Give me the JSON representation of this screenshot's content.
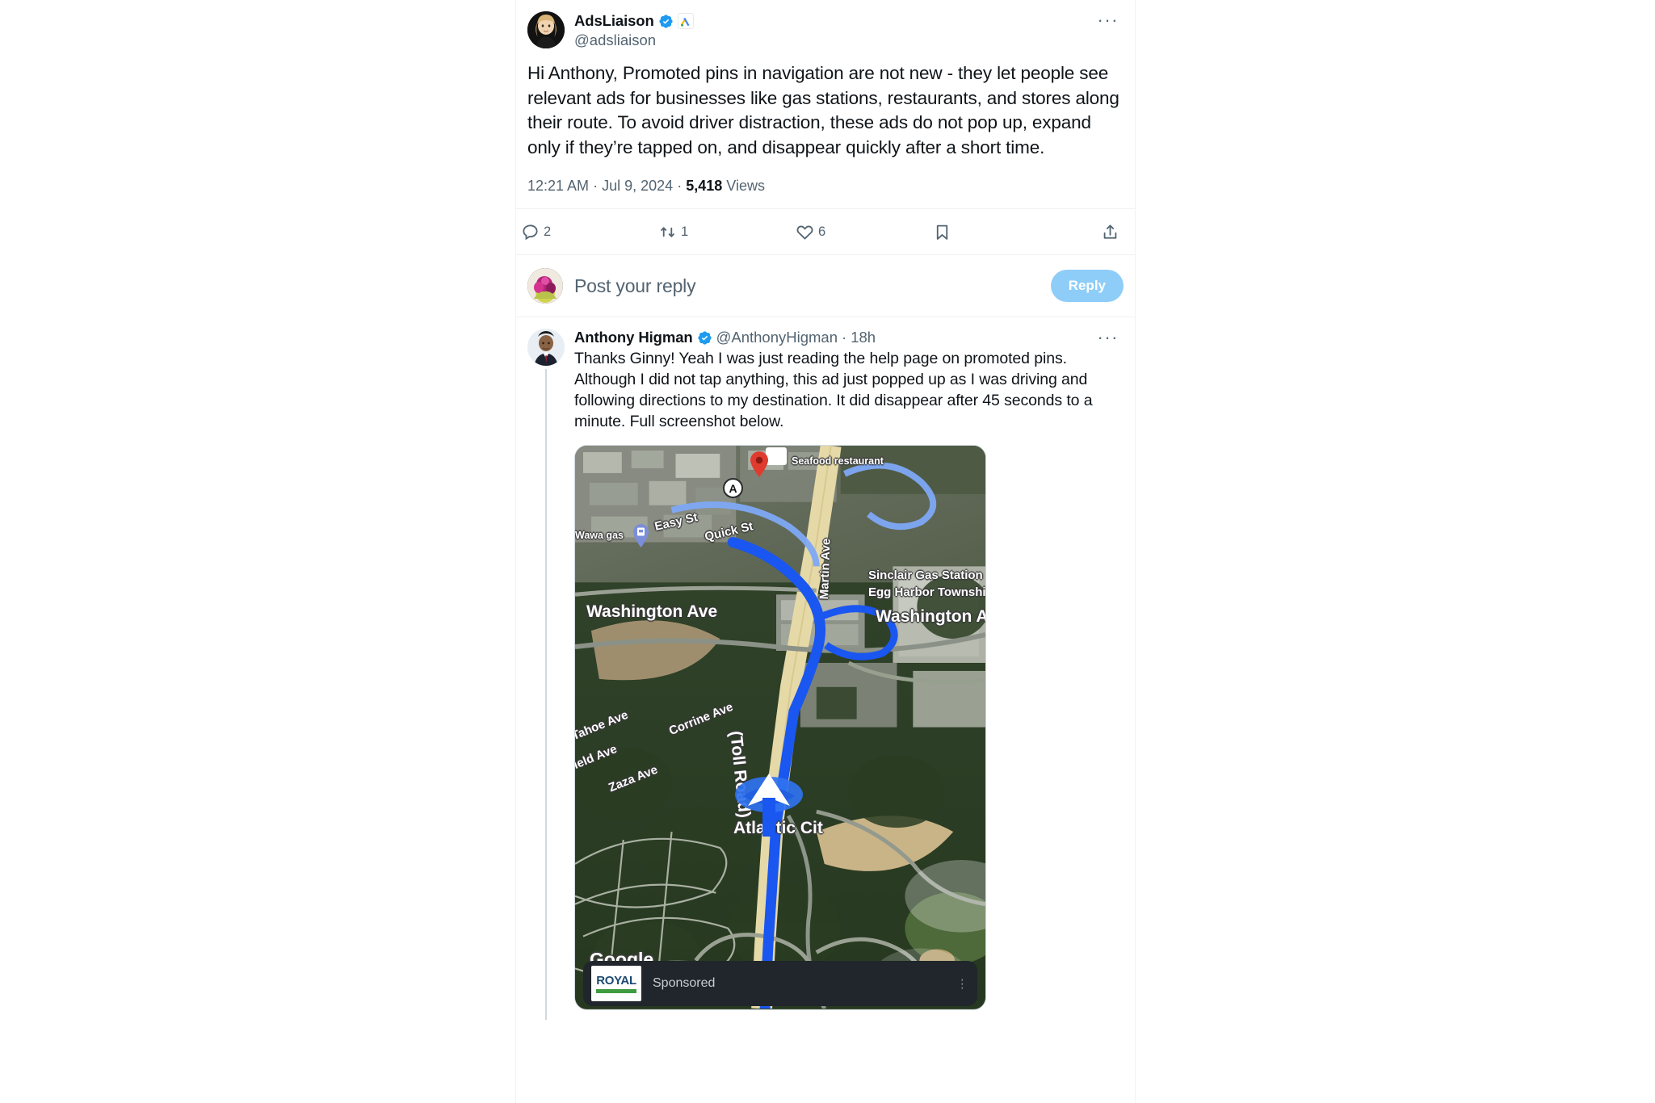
{
  "main_tweet": {
    "display_name": "AdsLiaison",
    "handle": "@adsliaison",
    "verified_icon": "verified-badge-icon",
    "affiliate_icon": "google-ads-icon",
    "more_label": "···",
    "text": "Hi Anthony, Promoted pins in navigation are not new - they let people see relevant ads for businesses like gas stations, restaurants, and stores along their route. To avoid driver distraction, these ads do not pop up, expand only if they’re tapped on, and disappear quickly after a short time.",
    "time": "12:21 AM",
    "date": "Jul 9, 2024",
    "views_count": "5,418",
    "views_label": "Views",
    "separator": "·",
    "actions": {
      "reply": {
        "icon": "reply-icon",
        "count": "2"
      },
      "retweet": {
        "icon": "retweet-icon",
        "count": "1"
      },
      "like": {
        "icon": "heart-icon",
        "count": "6"
      },
      "bookmark": {
        "icon": "bookmark-icon",
        "count": ""
      },
      "share": {
        "icon": "share-icon",
        "count": ""
      }
    }
  },
  "composer": {
    "placeholder": "Post your reply",
    "button_label": "Reply",
    "button_color": "#8ecdf8"
  },
  "reply_tweet": {
    "display_name": "Anthony Higman",
    "handle": "@AnthonyHigman",
    "separator": "·",
    "timestamp": "18h",
    "verified_icon": "verified-badge-icon",
    "more_label": "···",
    "text": "Thanks Ginny! Yeah I was just reading the help page on promoted pins. Although I did not tap anything, this ad just popped up as I was driving and following directions to my destination. It did disappear after 45 seconds to a minute. Full screenshot below."
  },
  "map_screenshot": {
    "provider_watermark": "Google",
    "marker_letter": "A",
    "labels": {
      "seafood": "Seafood restaurant",
      "easy_st": "Easy St",
      "quick_st": "Quick St",
      "wawa": "Wawa gas",
      "washington_left": "Washington Ave",
      "washington_right": "Washington Ave",
      "martin": "Martin Ave",
      "sinclair": "Sinclair Gas Station",
      "egg_harbor": "Egg Harbor Township",
      "tahoe": "Tahoe Ave",
      "corrine": "Corrine Ave",
      "field": "field Ave",
      "zaza": "Zaza Ave",
      "toll_road": "(Toll Road)",
      "atlantic_city": "Atlantic Cit"
    },
    "ad_banner": {
      "advertiser": "ROYAL",
      "label": "Sponsored",
      "menu_icon": "kebab-menu-icon",
      "background": "#20262b"
    }
  },
  "theme": {
    "accent": "#1d9bf0",
    "text": "#0f1419",
    "muted": "#536471",
    "border": "#eff3f4",
    "route_blue": "#1a56f0"
  }
}
